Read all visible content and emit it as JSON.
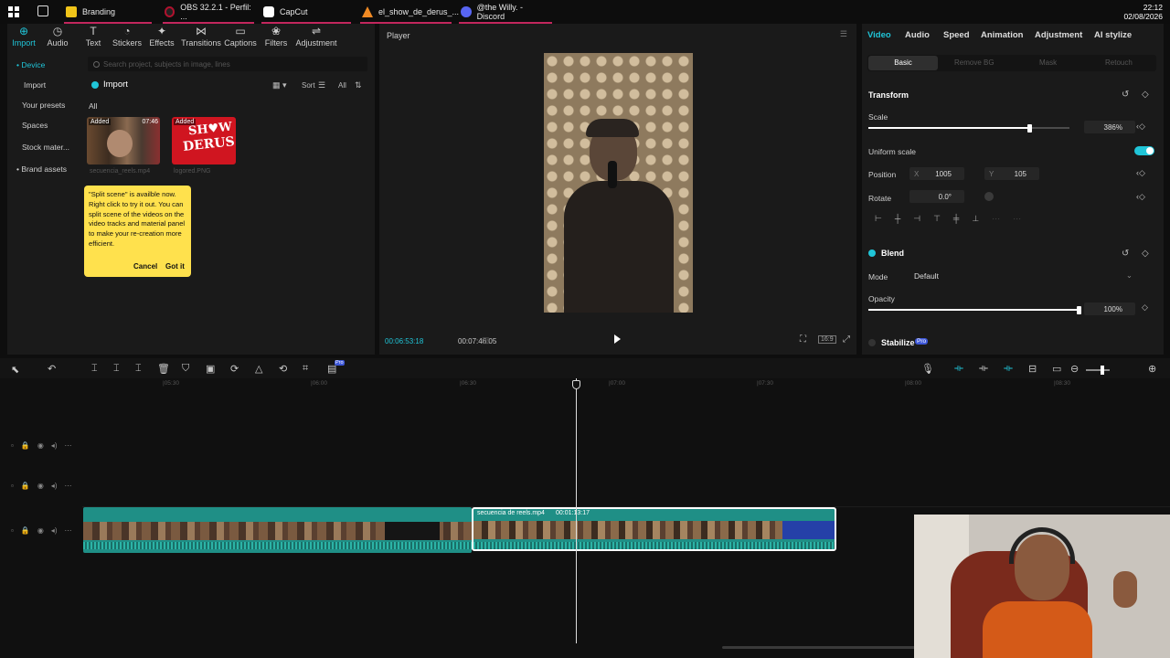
{
  "taskbar": {
    "clock_time": "22:12",
    "clock_date": "02/08/2026",
    "tabs": [
      {
        "label": "Branding",
        "color": "#f0c419"
      },
      {
        "label": "OBS 32.2.1 - Perfil: ...",
        "color": "#b0122e"
      },
      {
        "label": "CapCut",
        "color": "#ffffff"
      },
      {
        "label": "el_show_de_derus_...",
        "color": "#f08a24"
      },
      {
        "label": "@the Willy. - Discord",
        "color": "#5865f2"
      }
    ]
  },
  "toolbar": {
    "tabs": [
      {
        "label": "Import",
        "icon": "import-icon",
        "glyph": "⊕",
        "active": true
      },
      {
        "label": "Audio",
        "icon": "audio-icon",
        "glyph": "◷"
      },
      {
        "label": "Text",
        "icon": "text-icon",
        "glyph": "T"
      },
      {
        "label": "Stickers",
        "icon": "sticker-icon",
        "glyph": "◔"
      },
      {
        "label": "Effects",
        "icon": "effects-icon",
        "glyph": "✦"
      },
      {
        "label": "Transitions",
        "icon": "transitions-icon",
        "glyph": "⋈"
      },
      {
        "label": "Captions",
        "icon": "captions-icon",
        "glyph": "▭"
      },
      {
        "label": "Filters",
        "icon": "filters-icon",
        "glyph": "❀"
      },
      {
        "label": "Adjustment",
        "icon": "adjustment-icon",
        "glyph": "⇌"
      }
    ]
  },
  "media_sidebar": {
    "items": [
      "• Device",
      "Import",
      "Your presets",
      "Spaces",
      "Stock mater...",
      "• Brand assets"
    ]
  },
  "media": {
    "search_placeholder": "Search project, subjects in image, lines",
    "import_label": "Import",
    "sort_label": "Sort",
    "all_filter": "All",
    "all_label": "All",
    "items": [
      {
        "badge": "Added",
        "duration": "07:46",
        "name": "secuencia_reels.mp4"
      },
      {
        "badge": "Added",
        "name": "logored.PNG",
        "logo_text_1": "SH♥W",
        "logo_text_2": "DERUS"
      }
    ]
  },
  "tooltip": {
    "text": "\"Split scene\" is availble now. Right click to try it out. You can split scene of the videos on the video tracks and material panel to make your re-creation more efficient.",
    "cancel": "Cancel",
    "got_it": "Got it"
  },
  "player": {
    "title": "Player",
    "current_time": "00:06:53:18",
    "total_time": "00:07:46:05",
    "ratio_label": "16:9"
  },
  "properties": {
    "tabs": [
      "Video",
      "Audio",
      "Speed",
      "Animation",
      "Adjustment",
      "AI stylize"
    ],
    "subtabs": [
      "Basic",
      "Remove BG",
      "Mask",
      "Retouch"
    ],
    "transform_title": "Transform",
    "scale_label": "Scale",
    "scale_value": "386%",
    "scale_fraction": 0.8,
    "uniform_scale_label": "Uniform scale",
    "uniform_scale_on": true,
    "position_label": "Position",
    "position_x_label": "X",
    "position_x": "1005",
    "position_y_label": "Y",
    "position_y": "105",
    "rotate_label": "Rotate",
    "rotate_value": "0.0°",
    "blend_title": "Blend",
    "mode_label": "Mode",
    "mode_value": "Default",
    "opacity_label": "Opacity",
    "opacity_value": "100%",
    "opacity_fraction": 1.0,
    "stabilize_label": "Stabilize",
    "stabilize_badge": "Pro"
  },
  "timeline": {
    "ruler": [
      "|05:30",
      "|06:00",
      "|06:30",
      "|07:00",
      "|07:30",
      "|08:00",
      "|08:30"
    ],
    "clip_label": "secuencia de reels.mp4",
    "clip_duration": "00:01:13:17",
    "new_badge": "Pro"
  },
  "colors": {
    "accent": "#20c5d8",
    "panel": "#1a1a1a",
    "clip": "#1f8f86",
    "tooltip": "#ffe14d"
  }
}
